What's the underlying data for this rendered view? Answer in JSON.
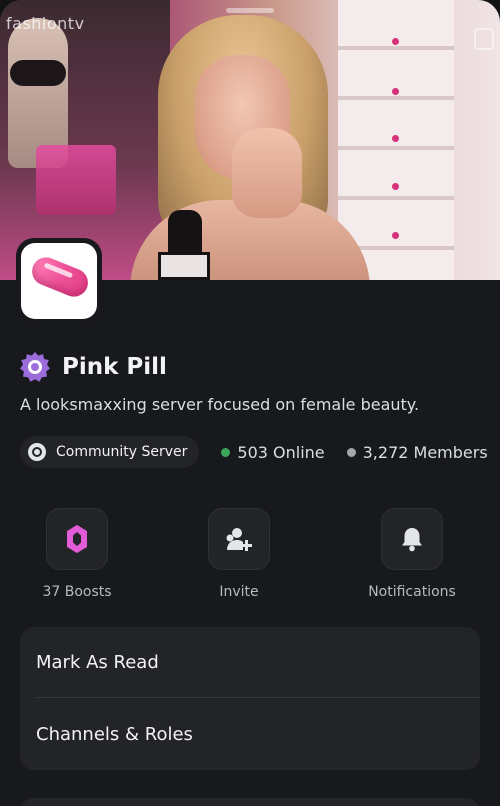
{
  "banner": {
    "watermark": "fashiontv",
    "icons": {
      "watermark_logo": "fashiontv-logo-icon",
      "corner": "copy-icon"
    }
  },
  "server": {
    "icon": "pink-pill-capsule",
    "badge_icon": "verified-globe-icon",
    "name": "Pink Pill",
    "description": "A looksmaxxing server focused on female beauty.",
    "type_chip": {
      "icon": "community-icon",
      "label": "Community Server"
    },
    "online": "503 Online",
    "members": "3,272 Members"
  },
  "actions": [
    {
      "icon": "boost-icon",
      "label": "37 Boosts"
    },
    {
      "icon": "add-friend-icon",
      "label": "Invite"
    },
    {
      "icon": "bell-icon",
      "label": "Notifications"
    }
  ],
  "menu": {
    "items": [
      {
        "label": "Mark As Read"
      },
      {
        "label": "Channels & Roles"
      }
    ]
  },
  "colors": {
    "background": "#18191c",
    "surface": "#232428",
    "online": "#3ba55c",
    "boost": "#e15cd6",
    "badge": "#9b6ddb"
  }
}
